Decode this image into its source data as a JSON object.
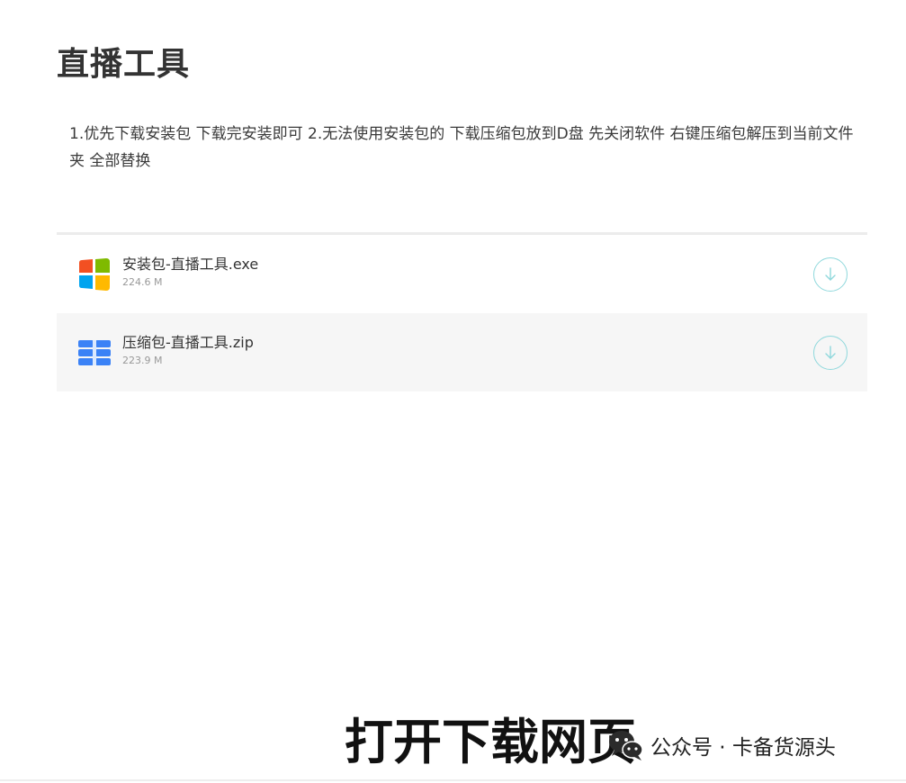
{
  "header": {
    "title": "直播工具"
  },
  "description": "1.优先下载安装包 下载完安装即可 2.无法使用安装包的 下载压缩包放到D盘 先关闭软件 右键压缩包解压到当前文件夹 全部替换",
  "files": [
    {
      "name": "安装包-直播工具.exe",
      "size": "224.6 M",
      "icon": "windows-icon"
    },
    {
      "name": "压缩包-直播工具.zip",
      "size": "223.9 M",
      "icon": "zip-archive-icon"
    }
  ],
  "overlay": {
    "caption": "打开下载网页",
    "brand": "公众号 · 卡备货源头",
    "brand_icon": "wechat-icon"
  },
  "colors": {
    "accent": "#8fd8dc",
    "windows_red": "#f25022",
    "windows_green": "#7fba00",
    "windows_blue": "#00a4ef",
    "windows_yellow": "#ffb900",
    "zip_blue": "#3b82f6"
  }
}
